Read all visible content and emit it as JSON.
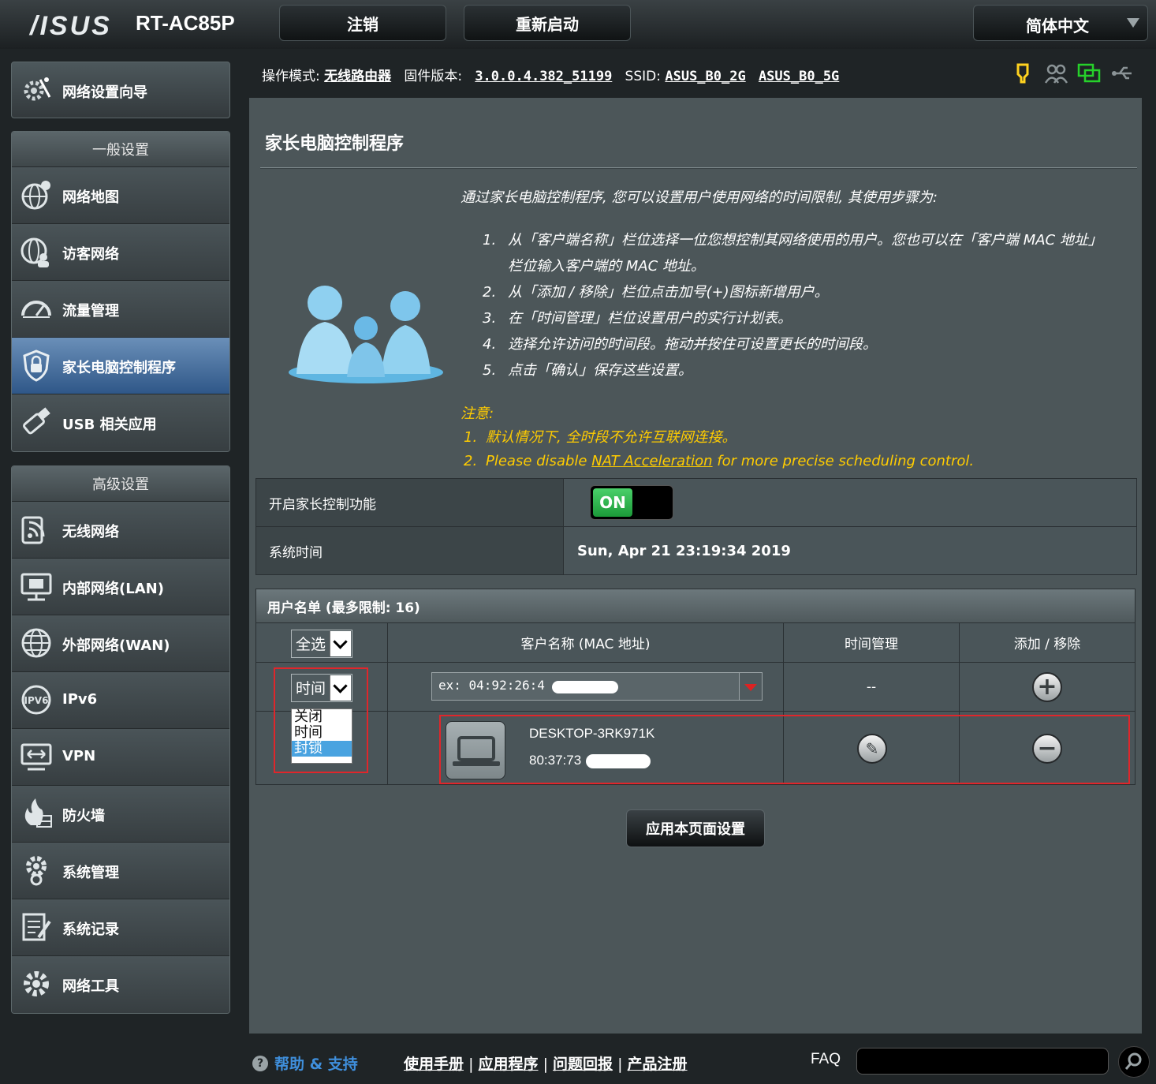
{
  "header": {
    "brand": "/ISUS",
    "model": "RT-AC85P",
    "logout_label": "注销",
    "reboot_label": "重新启动",
    "language": "简体中文"
  },
  "sidebar": {
    "quick_setup": "网络设置向导",
    "general_title": "一般设置",
    "general_items": [
      {
        "label": "网络地图",
        "icon": "globe-map-icon"
      },
      {
        "label": "访客网络",
        "icon": "guest-network-icon"
      },
      {
        "label": "流量管理",
        "icon": "speedometer-icon"
      },
      {
        "label": "家长电脑控制程序",
        "icon": "shield-lock-icon",
        "active": true
      },
      {
        "label": "USB 相关应用",
        "icon": "usb-icon"
      }
    ],
    "advanced_title": "高级设置",
    "advanced_items": [
      {
        "label": "无线网络",
        "icon": "wireless-icon"
      },
      {
        "label": "内部网络(LAN)",
        "icon": "lan-icon"
      },
      {
        "label": "外部网络(WAN)",
        "icon": "wan-globe-icon"
      },
      {
        "label": "IPv6",
        "icon": "ipv6-icon"
      },
      {
        "label": "VPN",
        "icon": "vpn-icon"
      },
      {
        "label": "防火墙",
        "icon": "firewall-icon"
      },
      {
        "label": "系统管理",
        "icon": "gear-admin-icon"
      },
      {
        "label": "系统记录",
        "icon": "log-icon"
      },
      {
        "label": "网络工具",
        "icon": "tools-gear-icon"
      }
    ]
  },
  "status": {
    "mode_label": "操作模式:",
    "mode_value": "无线路由器",
    "fw_label": "固件版本:",
    "fw_value": "3.0.0.4.382_51199",
    "ssid_label": "SSID:",
    "ssid_2g": "ASUS_B0_2G",
    "ssid_5g": "ASUS_B0_5G"
  },
  "page": {
    "title": "家长电脑控制程序",
    "intro": "通过家长电脑控制程序, 您可以设置用户使用网络的时间限制, 其使用步骤为:",
    "steps": [
      {
        "n": "1.",
        "text": "从「客户端名称」栏位选择一位您想控制其网络使用的用户。您也可以在「客户端 MAC 地址」栏位输入客户端的 MAC 地址。"
      },
      {
        "n": "2.",
        "text": "从「添加 / 移除」栏位点击加号(+)图标新增用户。"
      },
      {
        "n": "3.",
        "text": "在「时间管理」栏位设置用户的实行计划表。"
      },
      {
        "n": "4.",
        "text": "选择允许访问的时间段。拖动并按住可设置更长的时间段。"
      },
      {
        "n": "5.",
        "text": "点击「确认」保存这些设置。"
      }
    ],
    "note_title": "注意:",
    "note1_n": "1.",
    "note1": "默认情况下, 全时段不允许互联网连接。",
    "note2_n": "2.",
    "note2_pre": "Please disable ",
    "note2_link": "NAT Acceleration",
    "note2_post": " for more precise scheduling control."
  },
  "settings": {
    "enable_label": "开启家长控制功能",
    "enable_value": "ON",
    "time_label": "系统时间",
    "time_value": "Sun, Apr 21 23:19:34 2019"
  },
  "userlist": {
    "title": "用户名单 (最多限制: 16)",
    "select_all": "全选",
    "col_client": "客户名称 (MAC 地址)",
    "col_time": "时间管理",
    "col_add": "添加 / 移除",
    "mode_select": "时间",
    "mode_options": [
      "关闭",
      "时间",
      "封锁"
    ],
    "mode_highlight": "封锁",
    "mac_placeholder": "ex: 04:92:26:4",
    "time_empty": "--",
    "device_name": "DESKTOP-3RK971K",
    "device_mac": "80:37:73"
  },
  "apply_label": "应用本页面设置",
  "footer": {
    "help": "帮助 & 支持",
    "manual": "使用手册",
    "app": "应用程序",
    "feedback": "问题回报",
    "register": "产品注册",
    "sep": "|",
    "faq": "FAQ"
  },
  "colors": {
    "accent_active": "#2f5788",
    "note": "#ffcc00",
    "on_green": "#1c9a38",
    "highlight_box": "#e0262b"
  }
}
